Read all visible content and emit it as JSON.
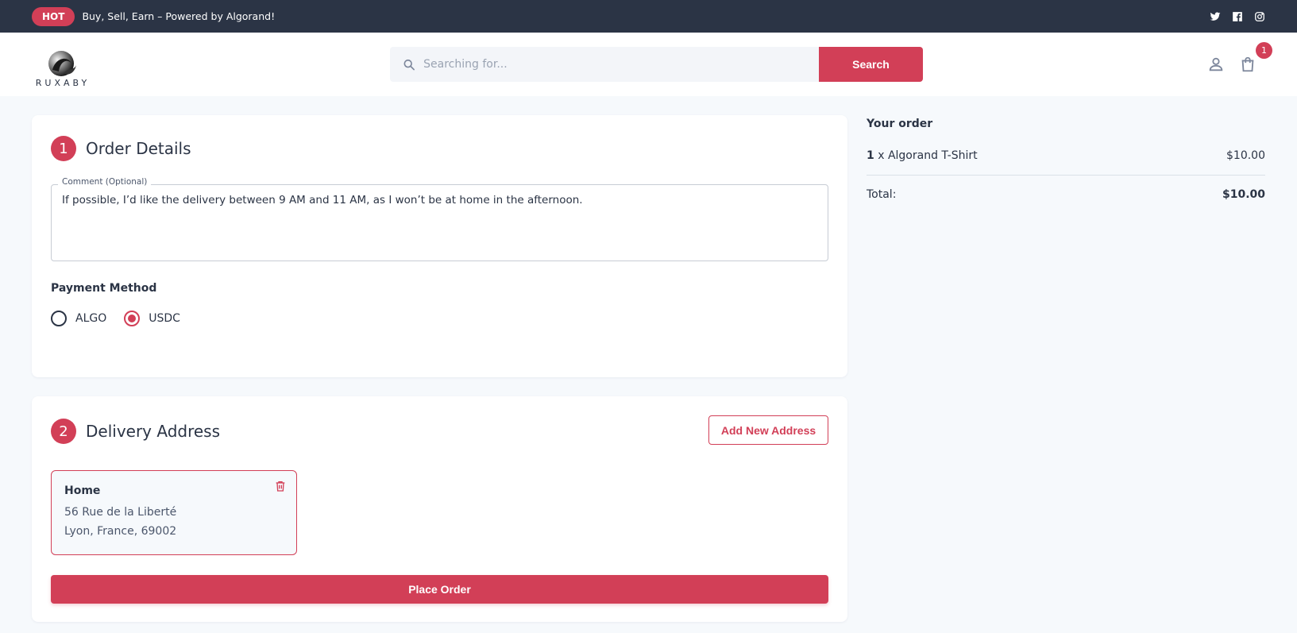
{
  "topbar": {
    "badge": "HOT",
    "promo": "Buy, Sell, Earn – Powered by Algorand!",
    "socials": [
      "twitter-icon",
      "facebook-icon",
      "instagram-icon"
    ]
  },
  "header": {
    "logo_text": "RUXABY",
    "search_placeholder": "Searching for...",
    "search_button": "Search",
    "cart_count": "1"
  },
  "order_details": {
    "step": "1",
    "title": "Order Details",
    "comment_label": "Comment (Optional)",
    "comment_value": "If possible, I’d like the delivery between 9 AM and 11 AM, as I won’t be at home in the afternoon.",
    "payment_label": "Payment Method",
    "payment_options": [
      {
        "label": "ALGO",
        "selected": false
      },
      {
        "label": "USDC",
        "selected": true
      }
    ]
  },
  "delivery": {
    "step": "2",
    "title": "Delivery Address",
    "add_button": "Add New Address",
    "address": {
      "name": "Home",
      "line1": "56 Rue de la Liberté",
      "line2": "Lyon, France, 69002"
    },
    "place_order": "Place Order"
  },
  "summary": {
    "title": "Your order",
    "item_qty": "1",
    "item_name": "x Algorand T-Shirt",
    "item_price": "$10.00",
    "total_label": "Total:",
    "total_value": "$10.00"
  },
  "colors": {
    "primary": "#d23f57",
    "dark": "#2b3445",
    "background": "#f6f9fc"
  }
}
